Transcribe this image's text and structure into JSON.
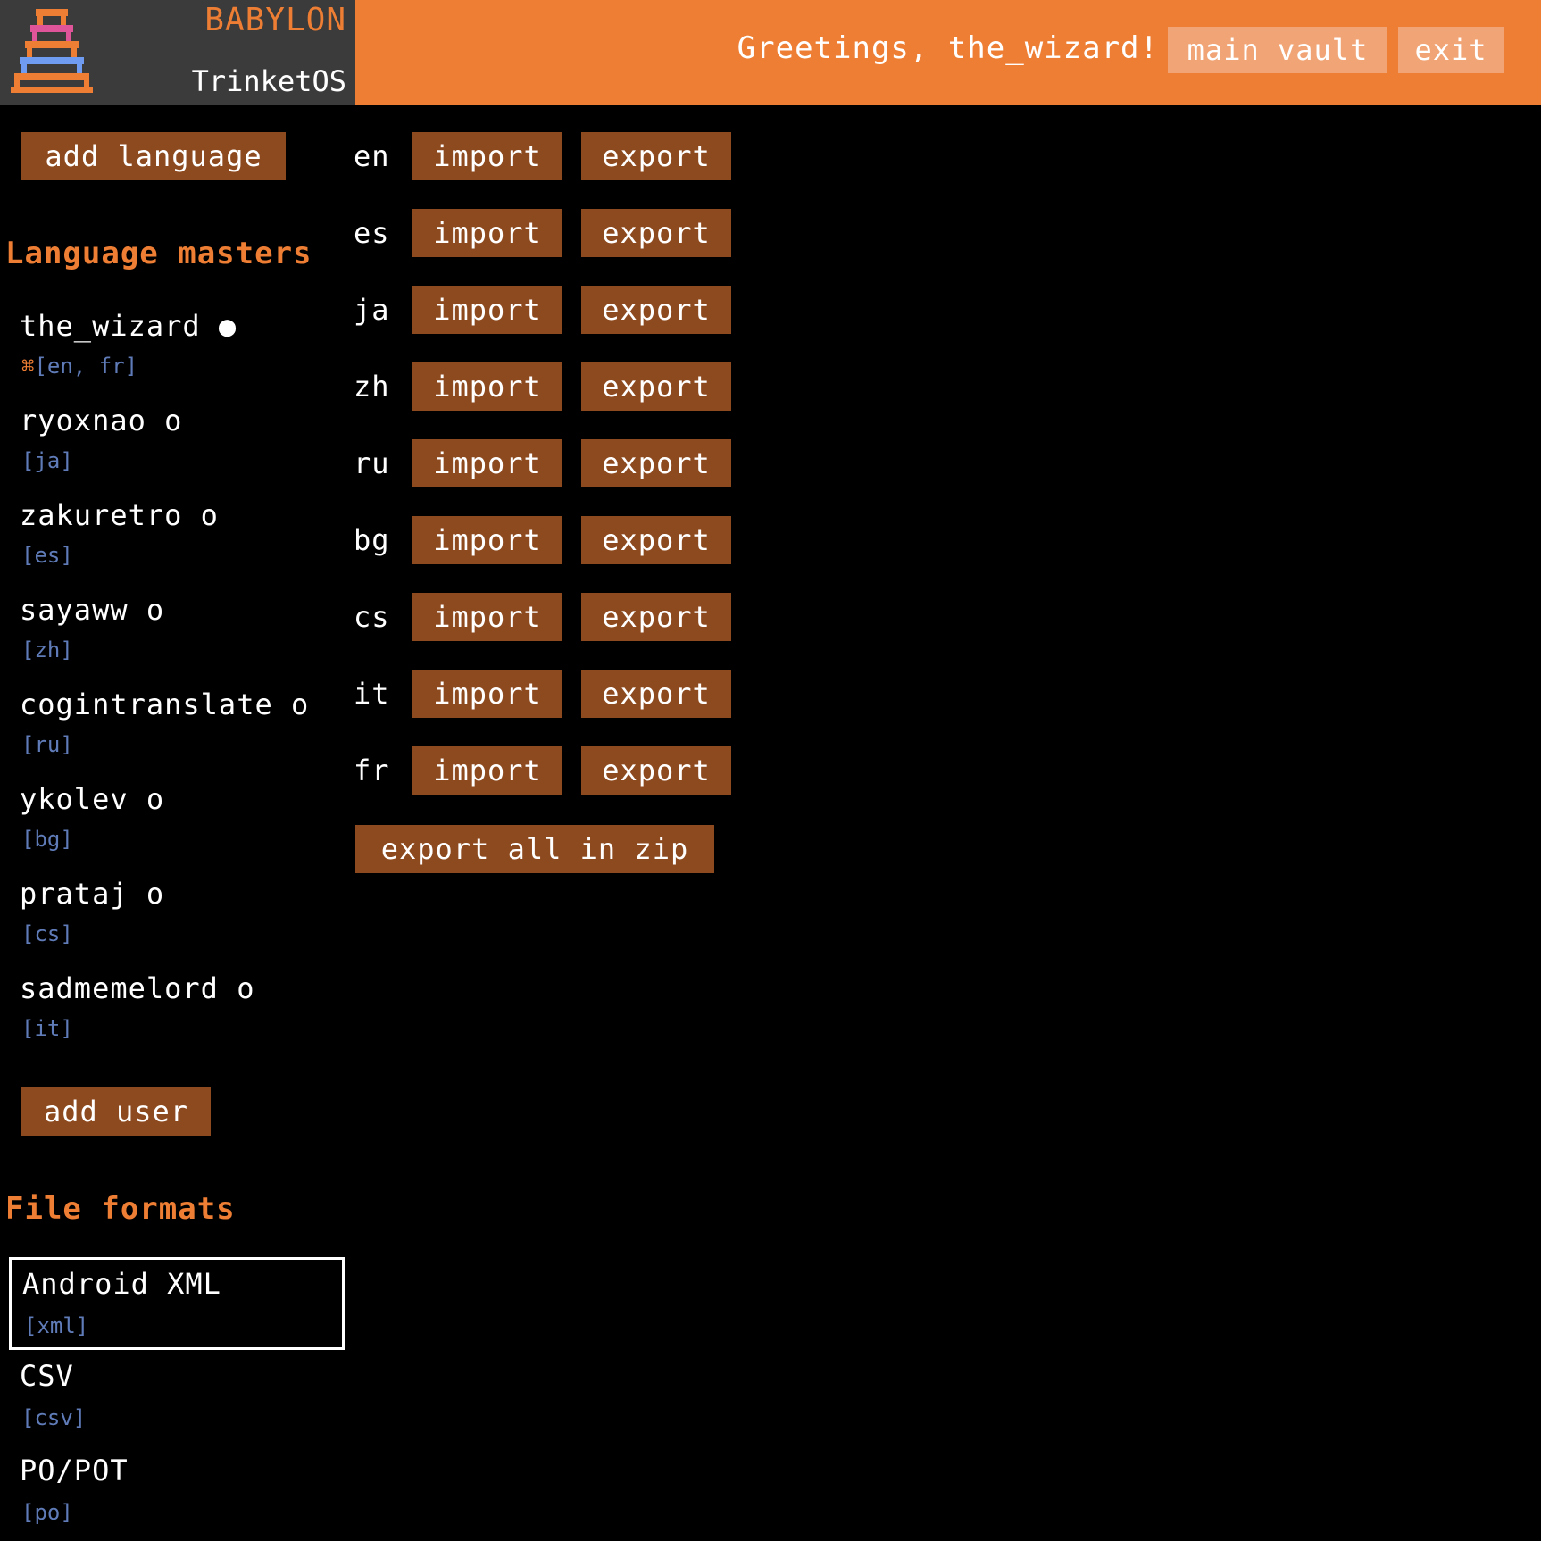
{
  "brand": {
    "name": "BABYLON",
    "os": "TrinketOS"
  },
  "header": {
    "greeting": "Greetings, the_wizard!",
    "main_vault_label": "main vault",
    "exit_label": "exit"
  },
  "sidebar": {
    "add_language_label": "add language",
    "masters_title": "Language masters",
    "users": [
      {
        "name": "the_wizard ●",
        "mark": "⌘",
        "langs": "[en, fr]"
      },
      {
        "name": "ryoxnao o",
        "langs": "[ja]"
      },
      {
        "name": "zakuretro o",
        "langs": "[es]"
      },
      {
        "name": "sayaww o",
        "langs": "[zh]"
      },
      {
        "name": "cogintranslate o",
        "langs": "[ru]"
      },
      {
        "name": "ykolev o",
        "langs": "[bg]"
      },
      {
        "name": "prataj o",
        "langs": "[cs]"
      },
      {
        "name": "sadmemelord o",
        "langs": "[it]"
      }
    ],
    "add_user_label": "add user",
    "formats_title": "File formats",
    "formats": [
      {
        "name": "Android XML",
        "ext": "[xml]"
      },
      {
        "name": "CSV",
        "ext": "[csv]"
      },
      {
        "name": "PO/POT",
        "ext": "[po]"
      }
    ]
  },
  "languages": {
    "import_label": "import",
    "export_label": "export",
    "codes": [
      "en",
      "es",
      "ja",
      "zh",
      "ru",
      "bg",
      "cs",
      "it",
      "fr"
    ],
    "export_all_label": "export all in zip"
  },
  "colors": {
    "accent": "#ee7e33",
    "button": "#8e4a1f",
    "header_button": "#f1a576",
    "brand_bg": "#3b3b3b",
    "lang_tag": "#5f7bb8"
  }
}
